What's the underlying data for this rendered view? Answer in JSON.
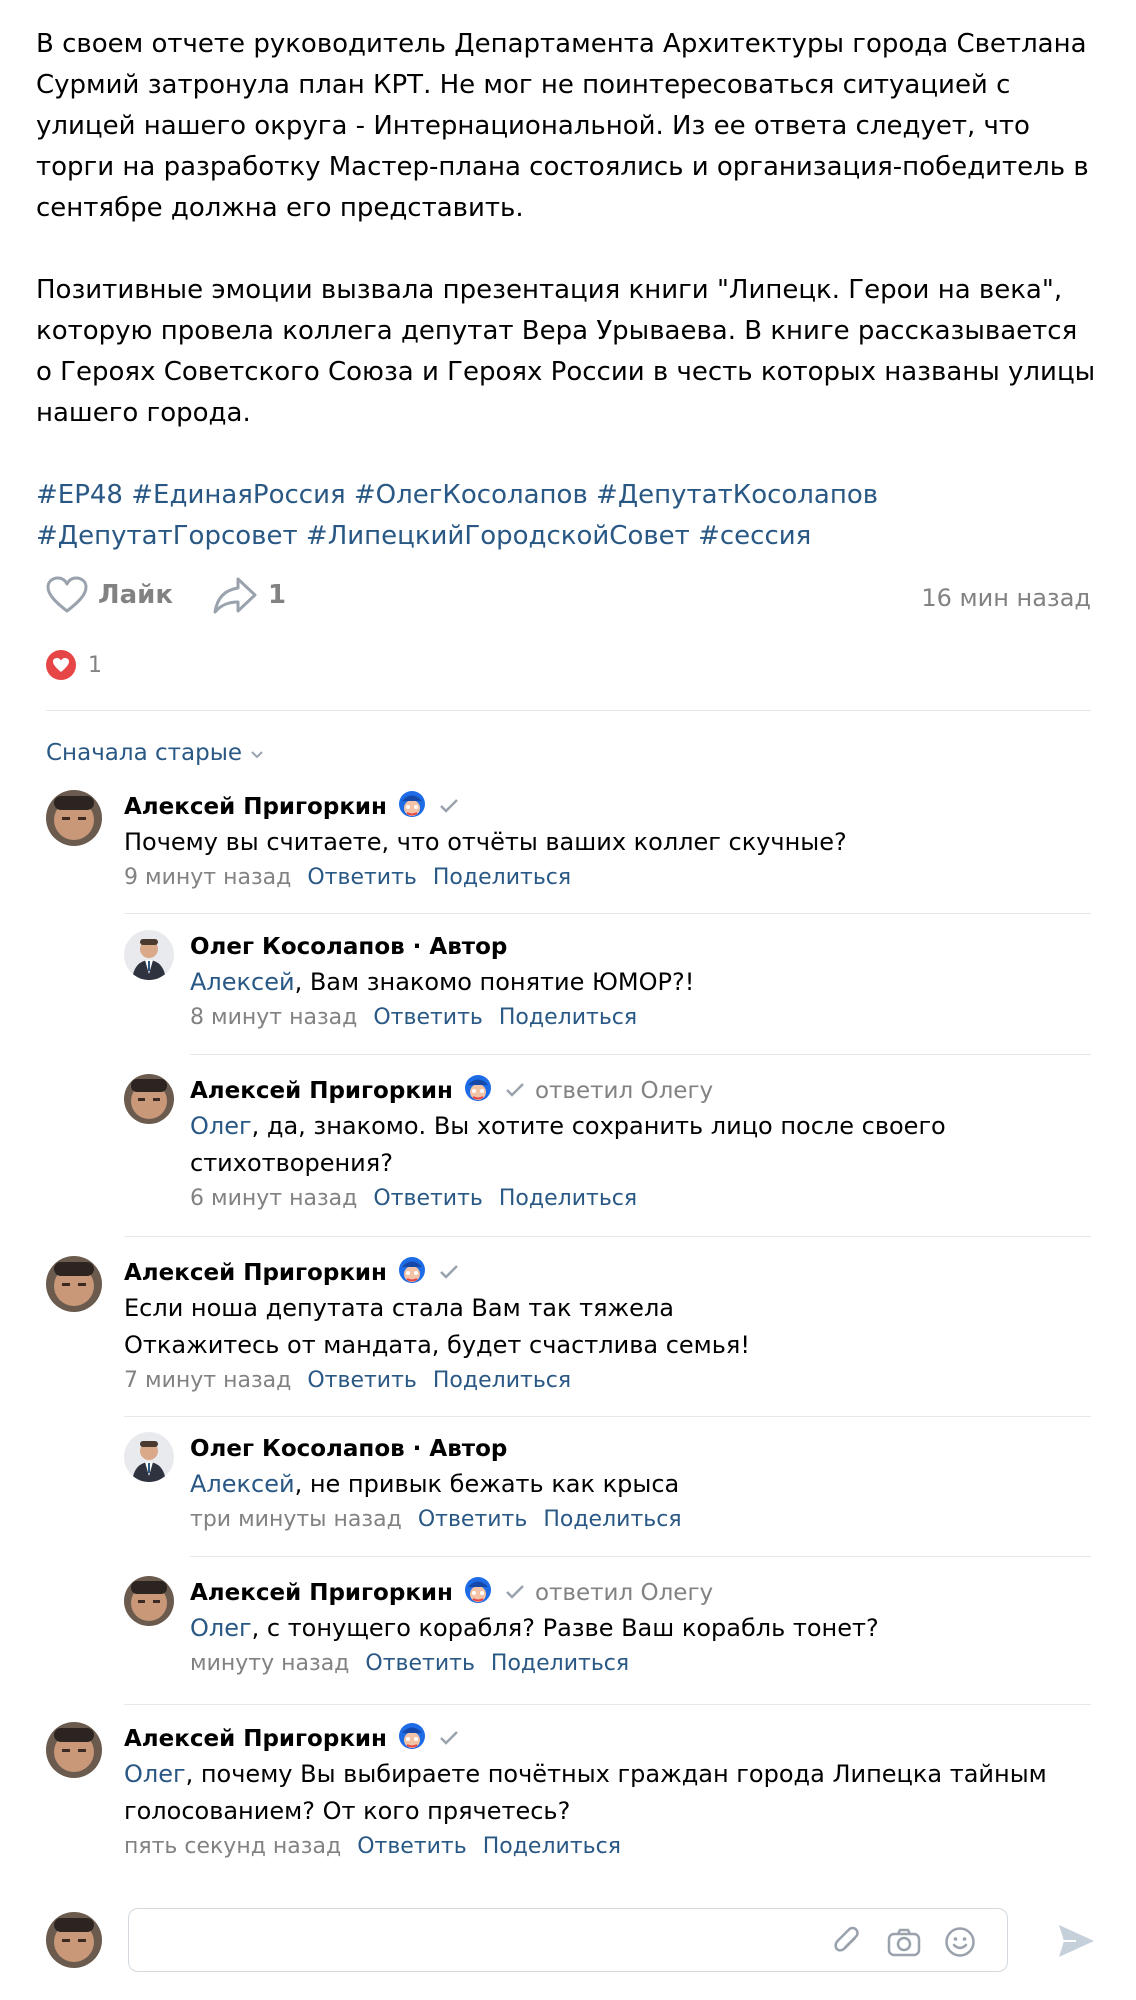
{
  "post": {
    "paragraphs": [
      "В своем отчете руководитель Департамента Архитектуры города Светлана Сурмий затронула план КРТ. Не мог не поинтересоваться ситуацией с улицей нашего округа - Интернациональной. Из ее ответа следует, что торги на разработку Мастер-плана состоялись и организация-победитель в сентябре должна его представить.",
      "Позитивные эмоции вызвала презентация книги \"Липецк. Герои на века\", которую провела коллега депутат Вера Урываева. В книге рассказывается о Героях Советского Союза и Героях России в честь которых названы улицы нашего города."
    ],
    "hashtags": [
      "#ЕР48",
      "#ЕдинаяРоссия",
      "#ОлегКосолапов",
      "#ДепутатКосолапов",
      "#ДепутатГорсовет",
      "#ЛипецкийГородскойСовет",
      "#сессия"
    ],
    "like_label": "Лайк",
    "share_count": "1",
    "time": "16 мин назад",
    "reaction_count": "1"
  },
  "comments": {
    "sort_label": "Сначала старые",
    "reply_label": "Ответить",
    "share_label": "Поделиться",
    "items": [
      {
        "author": "Алексей Пригоркин",
        "extra": "",
        "mention": "",
        "text": "Почему вы считаете, что отчёты ваших коллег скучные?",
        "time": "9 минут назад"
      },
      {
        "author": "Олег Косолапов · Автор",
        "extra": "",
        "mention": "Алексей",
        "text": ", Вам знакомо понятие ЮМОР?!",
        "time": "8 минут назад"
      },
      {
        "author": "Алексей Пригоркин",
        "extra": "ответил Олегу",
        "mention": "Олег",
        "text": ", да, знакомо. Вы хотите сохранить лицо после своего стихотворения?",
        "time": "6 минут назад"
      },
      {
        "author": "Алексей Пригоркин",
        "extra": "",
        "mention": "",
        "text": "Если ноша депутата стала Вам так тяжела\nОткажитесь от мандата, будет счастлива семья!",
        "time": "7 минут назад"
      },
      {
        "author": "Олег Косолапов · Автор",
        "extra": "",
        "mention": "Алексей",
        "text": ", не привык бежать как крыса",
        "time": "три минуты назад"
      },
      {
        "author": "Алексей Пригоркин",
        "extra": "ответил Олегу",
        "mention": "Олег",
        "text": ", с тонущего корабля? Разве Ваш корабль тонет?",
        "time": "минуту назад"
      },
      {
        "author": "Алексей Пригоркин",
        "extra": "",
        "mention": "Олег",
        "text": ", почему Вы выбираете почётных граждан города Липецка тайным голосованием? От кого прячетесь?",
        "time": "пять секунд назад"
      }
    ]
  },
  "icons": {
    "like": "heart-outline-icon",
    "share": "share-arrow-icon",
    "reaction": "heart-filled-icon",
    "sort": "chevron-down-icon",
    "badge": "gosuslugi-badge-icon",
    "verified": "checkmark-icon",
    "attach": "paperclip-icon",
    "camera": "camera-icon",
    "emoji": "smile-icon",
    "send": "send-icon"
  },
  "colors": {
    "link": "#2a5885",
    "secondary": "#828282",
    "divider": "#e7e8ec",
    "reaction": "#e64646"
  }
}
